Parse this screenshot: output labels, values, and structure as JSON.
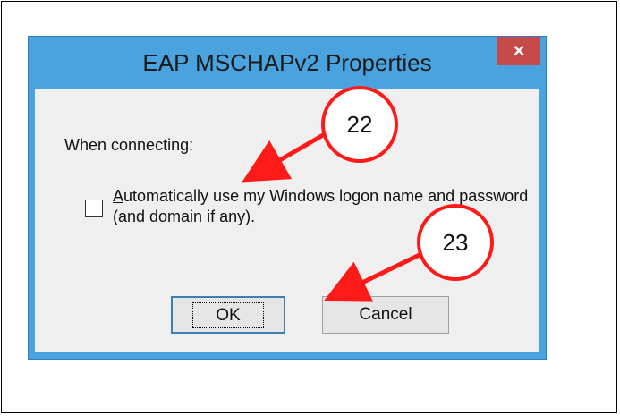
{
  "dialog": {
    "title": "EAP MSCHAPv2 Properties",
    "close_glyph": "×",
    "when_connecting_label": "When connecting:",
    "checkbox": {
      "checked": false,
      "label_underlined": "A",
      "label_rest": "utomatically use my Windows logon name and password (and domain if any)."
    },
    "ok_label": "OK",
    "cancel_label": "Cancel"
  },
  "callouts": [
    {
      "number": "22"
    },
    {
      "number": "23"
    }
  ],
  "colors": {
    "titlebar": "#4aa3df",
    "close_button": "#c74a4a",
    "client_area": "#efefef",
    "annotation": "#ff1a1a"
  }
}
